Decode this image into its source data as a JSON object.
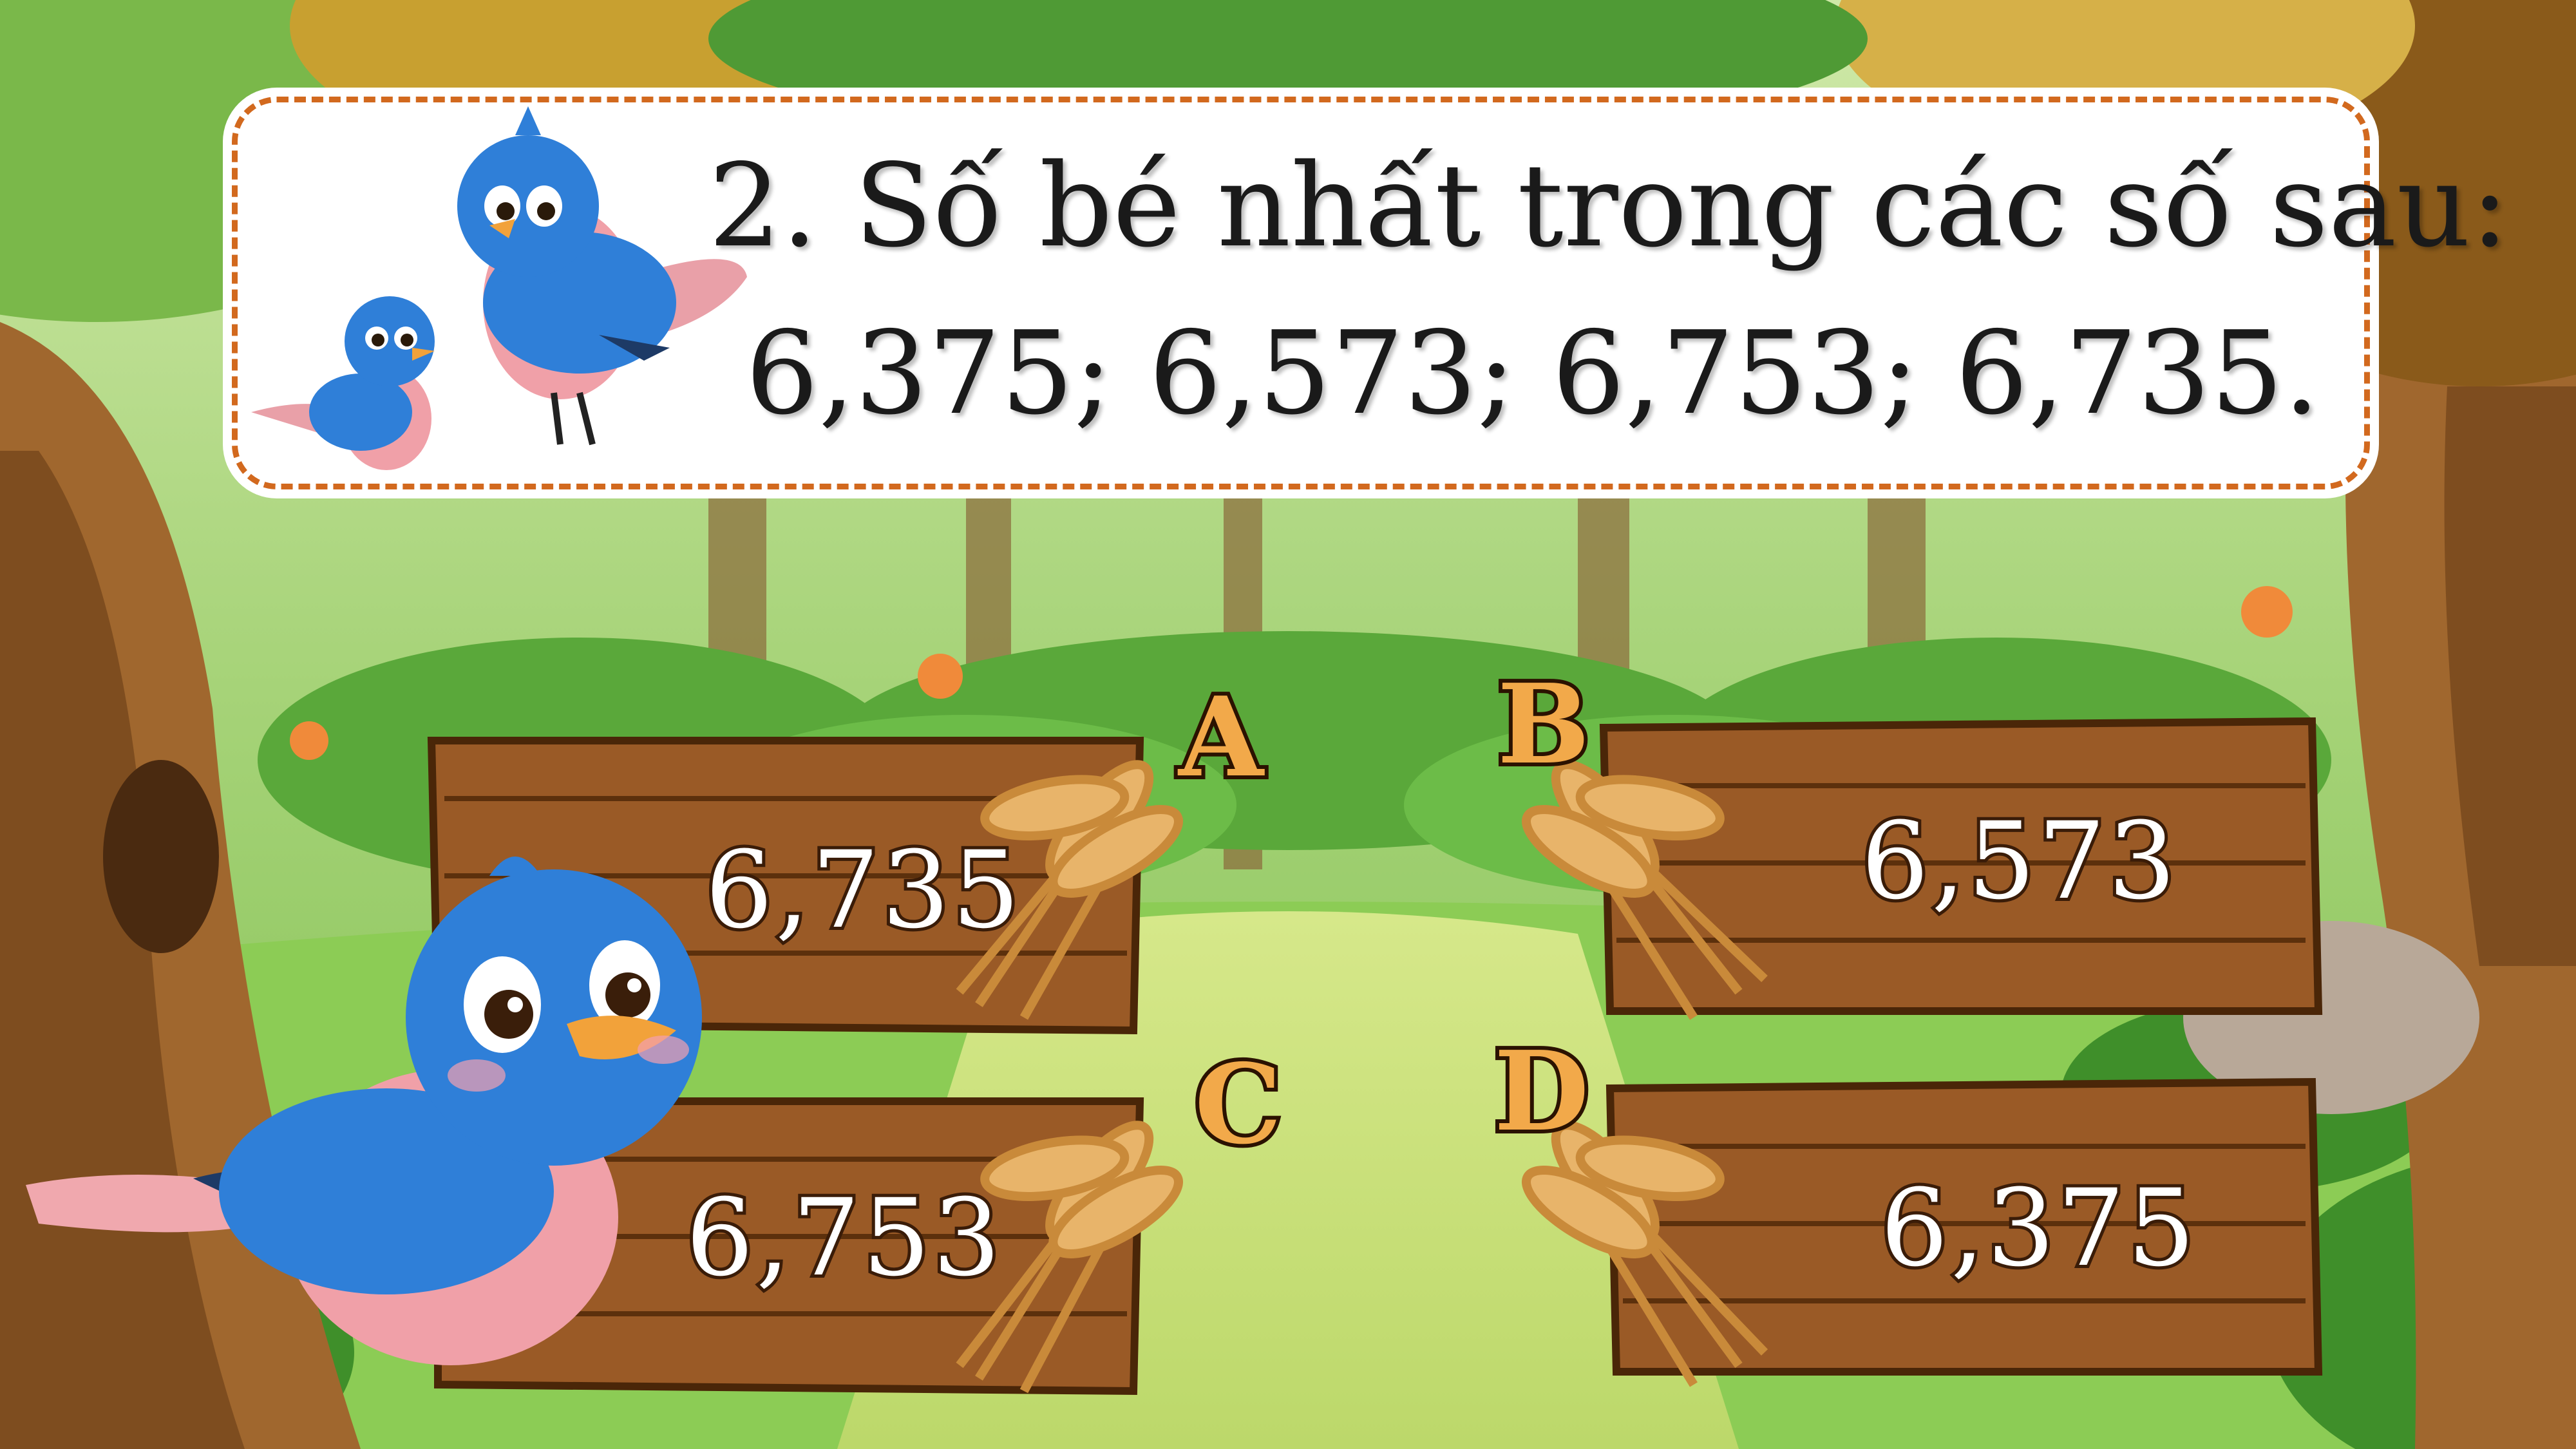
{
  "question": {
    "line1": "2. Số bé nhất trong các số sau:",
    "line2": "6,375; 6,573; 6,753; 6,735."
  },
  "options": [
    {
      "letter": "A",
      "value": "6,735"
    },
    {
      "letter": "B",
      "value": "6,573"
    },
    {
      "letter": "C",
      "value": "6,753"
    },
    {
      "letter": "D",
      "value": "6,375"
    }
  ],
  "colors": {
    "card_border": "#d2691e",
    "plank_wood": "#9a5a26",
    "letter_fill": "#f2a94a",
    "bird_blue": "#2f7fd8",
    "bird_pink": "#f0a0a8"
  }
}
